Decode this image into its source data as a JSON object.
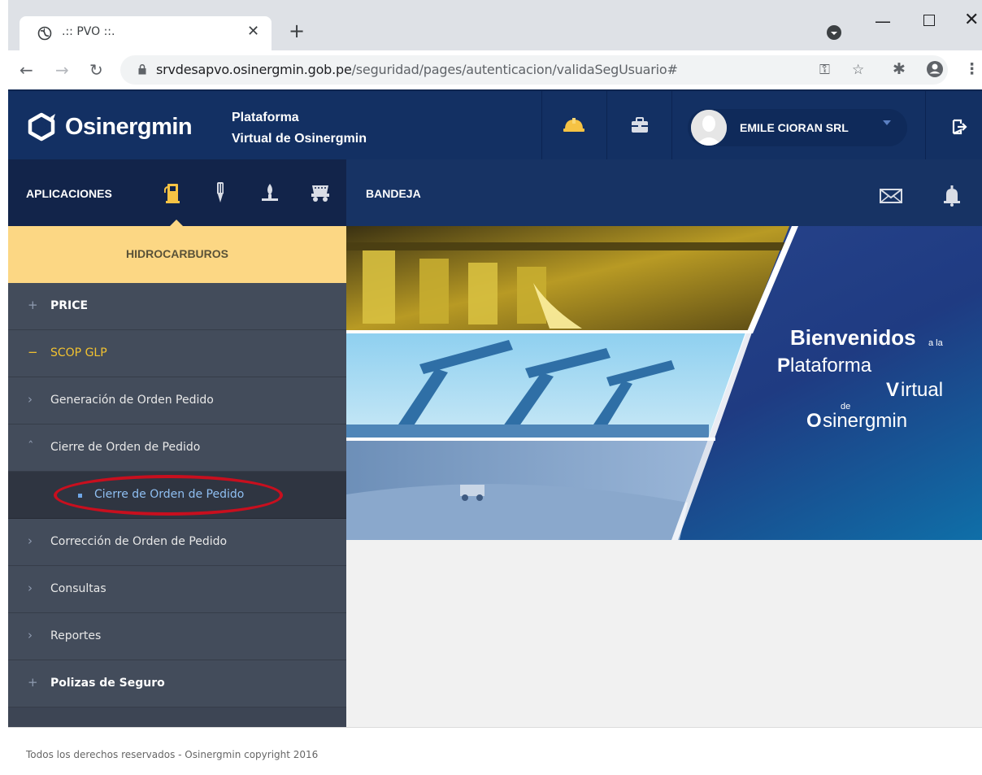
{
  "browser": {
    "tab_title": ".:: PVO ::.",
    "url_host": "srvdesapvo.osinergmin.gob.pe",
    "url_path": "/seguridad/pages/autenticacion/validaSegUsuario#"
  },
  "header": {
    "logo_text": "Osinergmin",
    "platform_line1": "Plataforma",
    "platform_line2": "Virtual de Osinergmin",
    "user_name": "EMILE CIORAN SRL"
  },
  "subheader": {
    "apps_label": "APLICACIONES",
    "bandeja_label": "BANDEJA"
  },
  "sidebar": {
    "title": "HIDROCARBUROS",
    "items": [
      {
        "mark": "+",
        "label": "PRICE"
      },
      {
        "mark": "−",
        "label": "SCOP GLP"
      },
      {
        "mark": "›",
        "label": "Generación de Orden Pedido"
      },
      {
        "mark": "ˆ",
        "label": "Cierre de Orden de Pedido"
      },
      {
        "label": "Cierre de Orden de Pedido"
      },
      {
        "mark": "›",
        "label": "Corrección de Orden de Pedido"
      },
      {
        "mark": "›",
        "label": "Consultas"
      },
      {
        "mark": "›",
        "label": "Reportes"
      },
      {
        "mark": "+",
        "label": "Polizas de Seguro"
      }
    ]
  },
  "banner": {
    "w1": "Bienvenidos",
    "w2": "a la",
    "w3": "P",
    "w4": "lataforma",
    "w5": "V",
    "w6": "irtual",
    "w7": "de",
    "w8": "O",
    "w9": "sinergmin"
  },
  "footer": {
    "text": "Todos los derechos reservados - Osinergmin copyright 2016"
  },
  "colors": {
    "header_bg": "#133063",
    "sidebar_title_bg": "#fcd784",
    "sidebar_bg": "#434c5b",
    "active_text": "#f2c230",
    "submenu_text": "#8fbff2",
    "highlight_ring": "#c80f1e"
  }
}
